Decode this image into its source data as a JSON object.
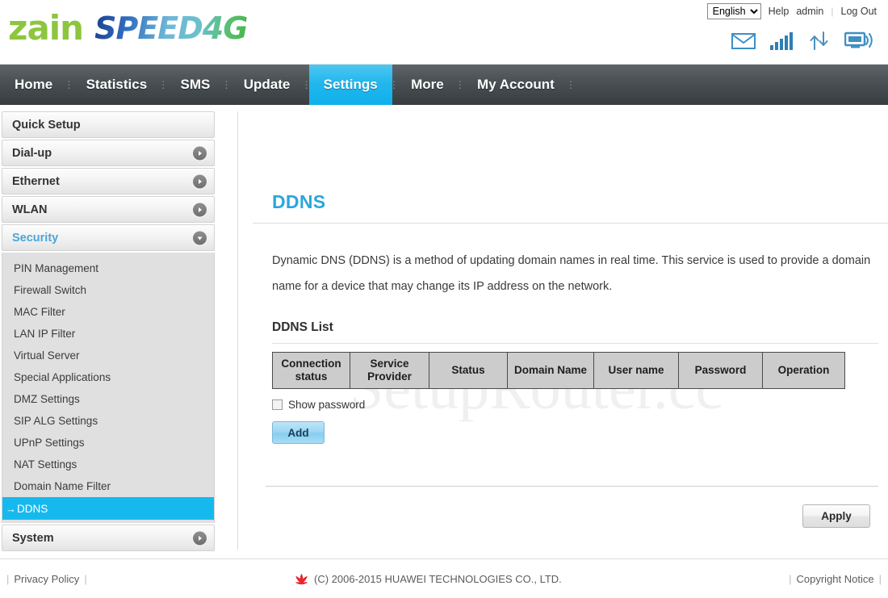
{
  "header": {
    "brand_primary": "zain",
    "brand_secondary": "SPEED4G",
    "language_selected": "English",
    "language_options": [
      "English"
    ],
    "help_label": "Help",
    "user_label": "admin",
    "logout_label": "Log Out",
    "status_icons": [
      "envelope-icon",
      "signal-bars-icon",
      "data-transfer-icon",
      "device-wifi-icon"
    ],
    "colors": {
      "zain_green": "#8cc63e",
      "speed_blue": "#1b3f8f"
    }
  },
  "nav": {
    "items": [
      {
        "label": "Home",
        "active": false
      },
      {
        "label": "Statistics",
        "active": false
      },
      {
        "label": "SMS",
        "active": false
      },
      {
        "label": "Update",
        "active": false
      },
      {
        "label": "Settings",
        "active": true
      },
      {
        "label": "More",
        "active": false
      },
      {
        "label": "My Account",
        "active": false
      }
    ],
    "active_color": "#16b9ee",
    "bar_color": "#4d5458"
  },
  "sidebar": {
    "groups": [
      {
        "label": "Quick Setup",
        "expandable": false,
        "open": false
      },
      {
        "label": "Dial-up",
        "expandable": true,
        "open": false
      },
      {
        "label": "Ethernet",
        "expandable": true,
        "open": false
      },
      {
        "label": "WLAN",
        "expandable": true,
        "open": false
      },
      {
        "label": "Security",
        "expandable": true,
        "open": true
      },
      {
        "label": "System",
        "expandable": true,
        "open": false
      }
    ],
    "security_items": [
      {
        "label": "PIN Management",
        "selected": false
      },
      {
        "label": "Firewall Switch",
        "selected": false
      },
      {
        "label": "MAC Filter",
        "selected": false
      },
      {
        "label": "LAN IP Filter",
        "selected": false
      },
      {
        "label": "Virtual Server",
        "selected": false
      },
      {
        "label": "Special Applications",
        "selected": false
      },
      {
        "label": "DMZ Settings",
        "selected": false
      },
      {
        "label": "SIP ALG Settings",
        "selected": false
      },
      {
        "label": "UPnP Settings",
        "selected": false
      },
      {
        "label": "NAT Settings",
        "selected": false
      },
      {
        "label": "Domain Name Filter",
        "selected": false
      },
      {
        "label": "DDNS",
        "selected": true
      }
    ],
    "selected_marker": "→",
    "selected_color": "#16b9ee"
  },
  "main": {
    "title": "DDNS",
    "title_color": "#2ba6dd",
    "description": "Dynamic DNS (DDNS) is a method of updating domain names in real time. This service is used to provide a domain name for a device that may change its IP address on the network.",
    "list_heading": "DDNS List",
    "table": {
      "columns": [
        "Connection status",
        "Service Provider",
        "Status",
        "Domain Name",
        "User name",
        "Password",
        "Operation"
      ],
      "rows": []
    },
    "show_password_label": "Show password",
    "show_password_checked": false,
    "add_button": "Add",
    "apply_button": "Apply",
    "watermark": "SetupRouter.cc"
  },
  "footer": {
    "privacy_label": "Privacy Policy",
    "copyright": "(C) 2006-2015 HUAWEI TECHNOLOGIES CO., LTD.",
    "copyright_notice_label": "Copyright Notice",
    "logo": "huawei-logo-icon"
  }
}
